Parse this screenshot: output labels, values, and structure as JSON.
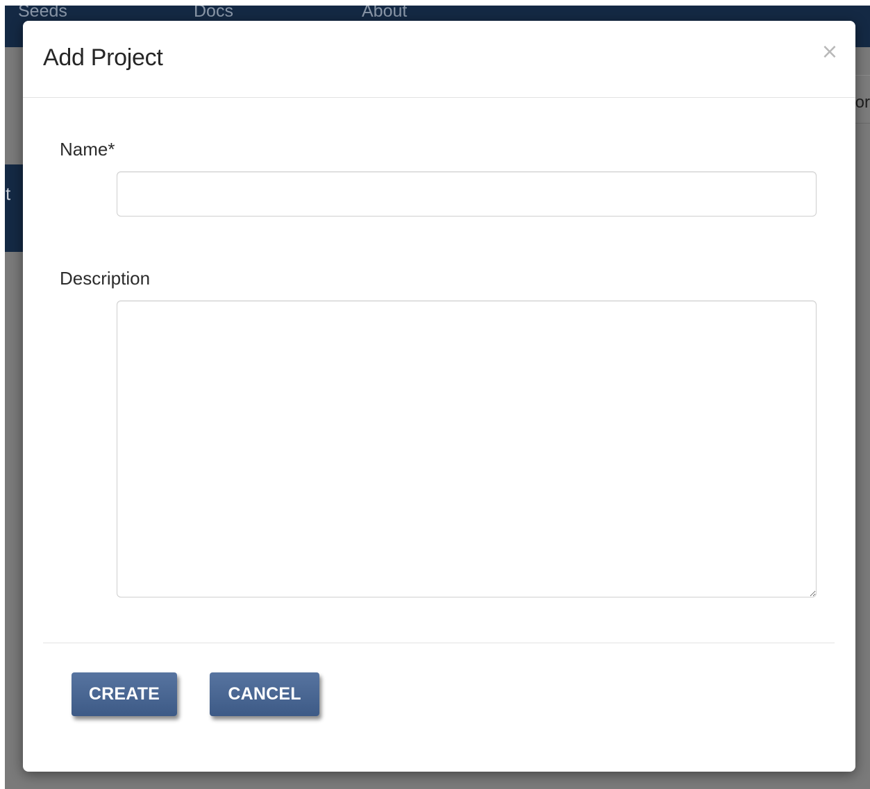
{
  "background": {
    "nav": {
      "items": [
        "Seeds",
        "Docs",
        "About"
      ]
    },
    "side_fragment": "t",
    "right_fragment": "or"
  },
  "modal": {
    "title": "Add Project",
    "close_glyph": "×",
    "fields": {
      "name": {
        "label": "Name*",
        "value": "",
        "placeholder": ""
      },
      "description": {
        "label": "Description",
        "value": "",
        "placeholder": ""
      }
    },
    "buttons": {
      "create_label": "CREATE",
      "cancel_label": "CANCEL"
    }
  },
  "colors": {
    "topbar": "#142944",
    "overlay": "#7a7a7a",
    "button": "#4a6792"
  }
}
